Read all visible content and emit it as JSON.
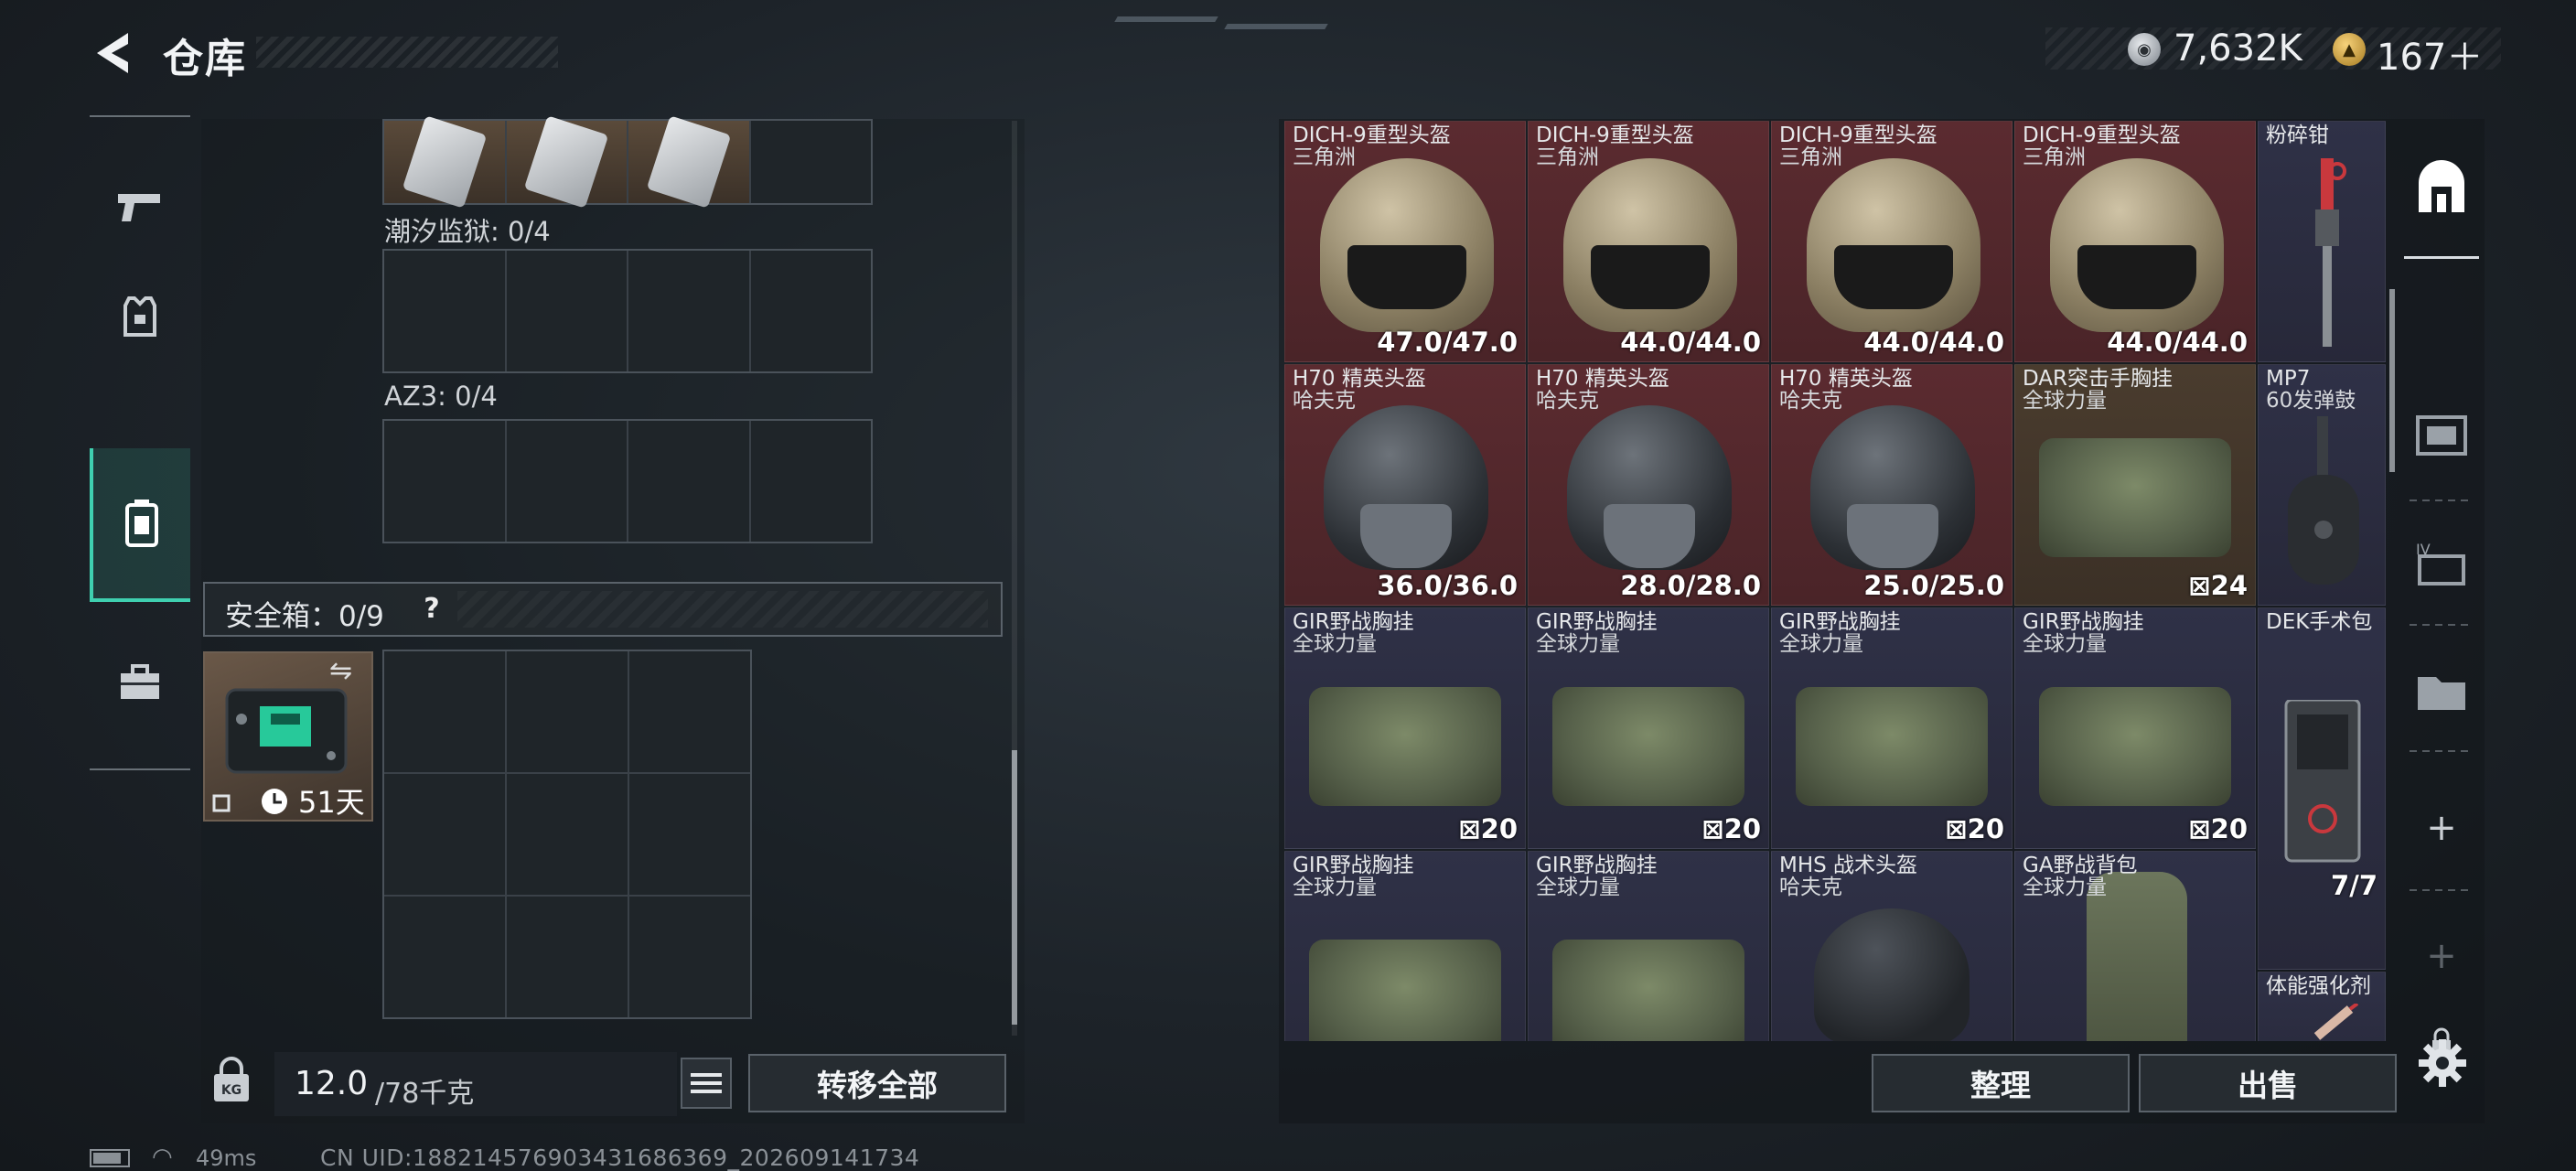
{
  "header": {
    "title": "仓库",
    "silver_amount": "7,632K",
    "gold_amount": "167＋"
  },
  "left_tabs": [
    {
      "icon": "pistol-icon"
    },
    {
      "icon": "armor-icon"
    },
    {
      "icon": "backpack-icon",
      "active": true
    },
    {
      "icon": "toolbox-icon"
    }
  ],
  "containers": {
    "tide_prison": "潮汐监狱: 0/4",
    "az3": "AZ3: 0/4",
    "safebox": "安全箱：0/9",
    "safebox_help": "?",
    "case_days": "51天"
  },
  "bottom_left": {
    "weight_current": "12.0",
    "weight_max": "/78千克",
    "transfer_all": "转移全部"
  },
  "inventory": [
    {
      "name": "DICH-9重型头盔",
      "sub": "三角洲",
      "value": "47.0/47.0",
      "rarity": "red"
    },
    {
      "name": "DICH-9重型头盔",
      "sub": "三角洲",
      "value": "44.0/44.0",
      "rarity": "red"
    },
    {
      "name": "DICH-9重型头盔",
      "sub": "三角洲",
      "value": "44.0/44.0",
      "rarity": "red"
    },
    {
      "name": "DICH-9重型头盔",
      "sub": "三角洲",
      "value": "44.0/44.0",
      "rarity": "red"
    },
    {
      "name": "粉碎钳",
      "sub": "",
      "value": "",
      "rarity": "purple"
    },
    {
      "name": "H70 精英头盔",
      "sub": "哈夫克",
      "value": "36.0/36.0",
      "rarity": "red"
    },
    {
      "name": "H70 精英头盔",
      "sub": "哈夫克",
      "value": "28.0/28.0",
      "rarity": "red"
    },
    {
      "name": "H70 精英头盔",
      "sub": "哈夫克",
      "value": "25.0/25.0",
      "rarity": "red"
    },
    {
      "name": "DAR突击手胸挂",
      "sub": "全球力量",
      "value": "24",
      "rarity": "gold"
    },
    {
      "name": "MP7",
      "sub": "60发弹鼓",
      "value": "",
      "rarity": "purple"
    },
    {
      "name": "GIR野战胸挂",
      "sub": "全球力量",
      "value": "20",
      "rarity": "purple"
    },
    {
      "name": "GIR野战胸挂",
      "sub": "全球力量",
      "value": "20",
      "rarity": "purple"
    },
    {
      "name": "GIR野战胸挂",
      "sub": "全球力量",
      "value": "20",
      "rarity": "purple"
    },
    {
      "name": "GIR野战胸挂",
      "sub": "全球力量",
      "value": "20",
      "rarity": "purple"
    },
    {
      "name": "DEK手术包",
      "sub": "",
      "value": "7/7",
      "rarity": "purple"
    },
    {
      "name": "GIR野战胸挂",
      "sub": "全球力量",
      "value": "",
      "rarity": "purple"
    },
    {
      "name": "GIR野战胸挂",
      "sub": "全球力量",
      "value": "",
      "rarity": "purple"
    },
    {
      "name": "MHS 战术头盔",
      "sub": "哈夫克",
      "value": "",
      "rarity": "purple"
    },
    {
      "name": "GA野战背包",
      "sub": "全球力量",
      "value": "",
      "rarity": "purple"
    },
    {
      "name": "体能强化剂",
      "sub": "",
      "value": "",
      "rarity": "purple"
    }
  ],
  "right_actions": {
    "sort": "整理",
    "sell": "出售"
  },
  "status": {
    "ping": "49ms",
    "uid": "CN UID:1882145769034316863​69_202609141734"
  },
  "colors": {
    "accent": "#3fd0b0",
    "red_rarity": "#5b2b30",
    "gold_rarity": "#4a3c2e",
    "purple_rarity": "#2f3147"
  }
}
